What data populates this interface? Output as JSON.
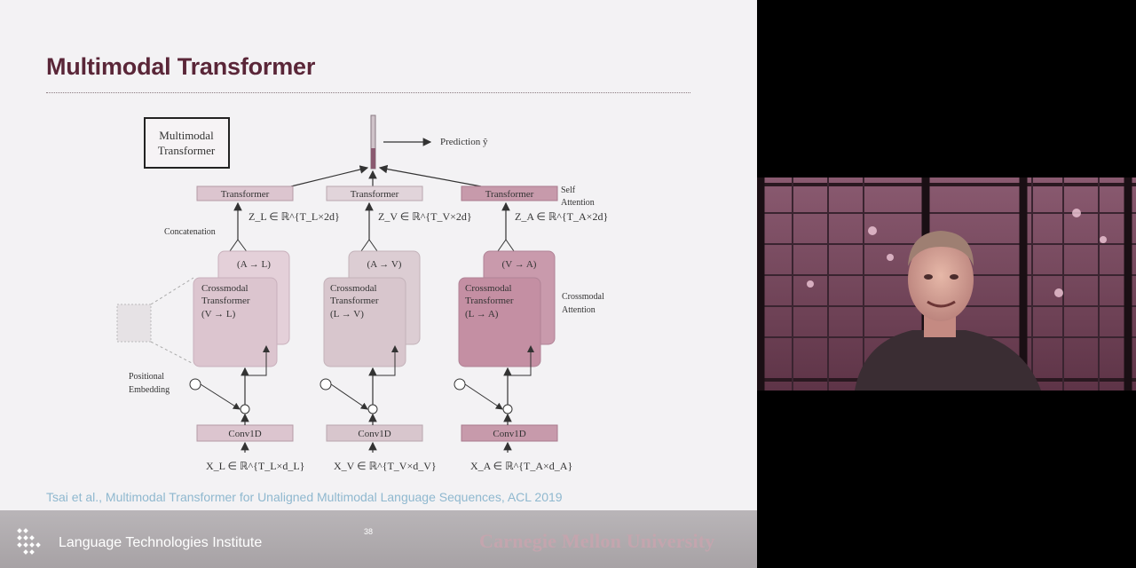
{
  "slide": {
    "title": "Multimodal Transformer",
    "citation": "Tsai et al., Multimodal Transformer for Unaligned Multimodal Language Sequences, ACL 2019",
    "page_number": "38",
    "footer_institute": "Language Technologies Institute",
    "footer_university": "Carnegie Mellon University"
  },
  "diagram": {
    "legend_box": [
      "Multimodal",
      "Transformer"
    ],
    "prediction_label": "Prediction ŷ",
    "side_labels": {
      "self_attention": [
        "Self",
        "Attention"
      ],
      "crossmodal_attention": [
        "Crossmodal",
        "Attention"
      ],
      "concatenation": "Concatenation",
      "positional_embedding": [
        "Positional",
        "Embedding"
      ]
    },
    "columns": [
      {
        "transformer": "Transformer",
        "z_label": "Z_L ∈ ℝ^{T_L×2d}",
        "back_card": "(A → L)",
        "cross_lines": [
          "Crossmodal",
          "Transformer",
          "(V → L)"
        ],
        "conv": "Conv1D",
        "x_label": "X_L ∈ ℝ^{T_L×d_L}",
        "color": "#dcc5cf"
      },
      {
        "transformer": "Transformer",
        "z_label": "Z_V ∈ ℝ^{T_V×2d}",
        "back_card": "(A → V)",
        "cross_lines": [
          "Crossmodal",
          "Transformer",
          "(L → V)"
        ],
        "conv": "Conv1D",
        "x_label": "X_V ∈ ℝ^{T_V×d_V}",
        "color": "#d8c6cd"
      },
      {
        "transformer": "Transformer",
        "z_label": "Z_A ∈ ℝ^{T_A×2d}",
        "back_card": "(V → A)",
        "cross_lines": [
          "Crossmodal",
          "Transformer",
          "(L → A)"
        ],
        "conv": "Conv1D",
        "x_label": "X_A ∈ ℝ^{T_A×d_A}",
        "color": "#c79aab"
      }
    ]
  },
  "colors": {
    "title": "#5a2638",
    "citation": "#8fb8cf",
    "footer": "#b0acaf",
    "cmu": "#c4a5ae",
    "webcam_curtain": "#6c3f53"
  },
  "webcam": {
    "description_icon": "presenter-video-feed"
  }
}
